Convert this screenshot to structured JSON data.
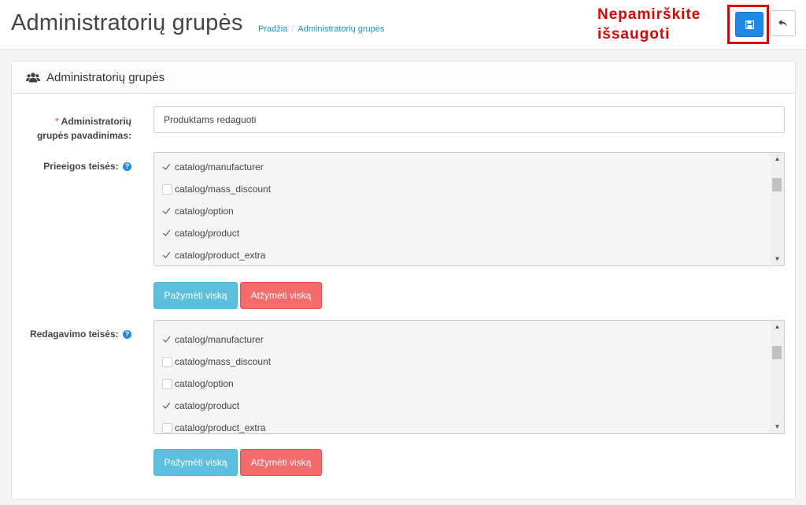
{
  "header": {
    "title": "Administratorių grupės",
    "breadcrumb": [
      {
        "label": "Pradžia"
      },
      {
        "label": "Administratorių grupės"
      }
    ],
    "breadcrumb_separator": "/",
    "reminder_line1": "Nepamirškite",
    "reminder_line2": "išsaugoti"
  },
  "panel": {
    "title": "Administratorių grupės"
  },
  "form": {
    "name_label_line1": "Administratorių",
    "name_label_line2": "grupės pavadinimas:",
    "required_mark": "*",
    "name_value": "Produktams redaguoti",
    "access_label": "Prieeigos teisės:",
    "modify_label": "Redagavimo teisės:",
    "help_glyph": "?",
    "access_items": [
      {
        "label": "catalog/manufacturer",
        "checked": true
      },
      {
        "label": "catalog/mass_discount",
        "checked": false
      },
      {
        "label": "catalog/option",
        "checked": true
      },
      {
        "label": "catalog/product",
        "checked": true
      },
      {
        "label": "catalog/product_extra",
        "checked": true
      }
    ],
    "modify_items": [
      {
        "label": "catalog/manufacturer",
        "checked": true
      },
      {
        "label": "catalog/mass_discount",
        "checked": false
      },
      {
        "label": "catalog/option",
        "checked": false
      },
      {
        "label": "catalog/product",
        "checked": true
      },
      {
        "label": "catalog/product_extra",
        "checked": false
      }
    ],
    "select_all_label": "Pažymėti viską",
    "unselect_all_label": "Atžymėti viską"
  },
  "icons": {
    "save": "save-icon",
    "back": "reply-icon",
    "group": "users-icon",
    "help": "help-icon"
  },
  "colors": {
    "primary": "#1e88e5",
    "info": "#5bc0de",
    "danger": "#f56b6b",
    "reminder": "#e00000",
    "link": "#1e91cf"
  }
}
